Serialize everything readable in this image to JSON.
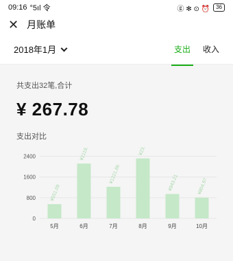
{
  "status_bar": {
    "time": "09:16",
    "signal": "°5ıl 令",
    "icons": "ⓖ ✻ ⊙ ⏰",
    "battery": "36"
  },
  "header": {
    "close_icon": "✕",
    "title": "月账单"
  },
  "filter": {
    "month": "2018年1月",
    "tabs": [
      {
        "label": "支出",
        "active": true
      },
      {
        "label": "收入",
        "active": false
      }
    ]
  },
  "summary": {
    "label": "共支出32笔,合计",
    "amount": "¥ 267.78"
  },
  "chart": {
    "title": "支出对比"
  },
  "chart_data": {
    "type": "bar",
    "categories": [
      "5月",
      "6月",
      "7月",
      "8月",
      "9月",
      "10月"
    ],
    "values": [
      551.09,
      2119.11,
      1221.86,
      2317.75,
      943.21,
      804.97
    ],
    "data_labels": [
      "¥551.09",
      "¥2119.11",
      "¥1221.86",
      "¥2317.75",
      "¥943.21",
      "¥804.97"
    ],
    "y_ticks": [
      0,
      800,
      1600,
      2400
    ],
    "ylim": [
      0,
      2600
    ],
    "bar_color": "#c5e8c8",
    "label_color": "#a8d8ab"
  }
}
